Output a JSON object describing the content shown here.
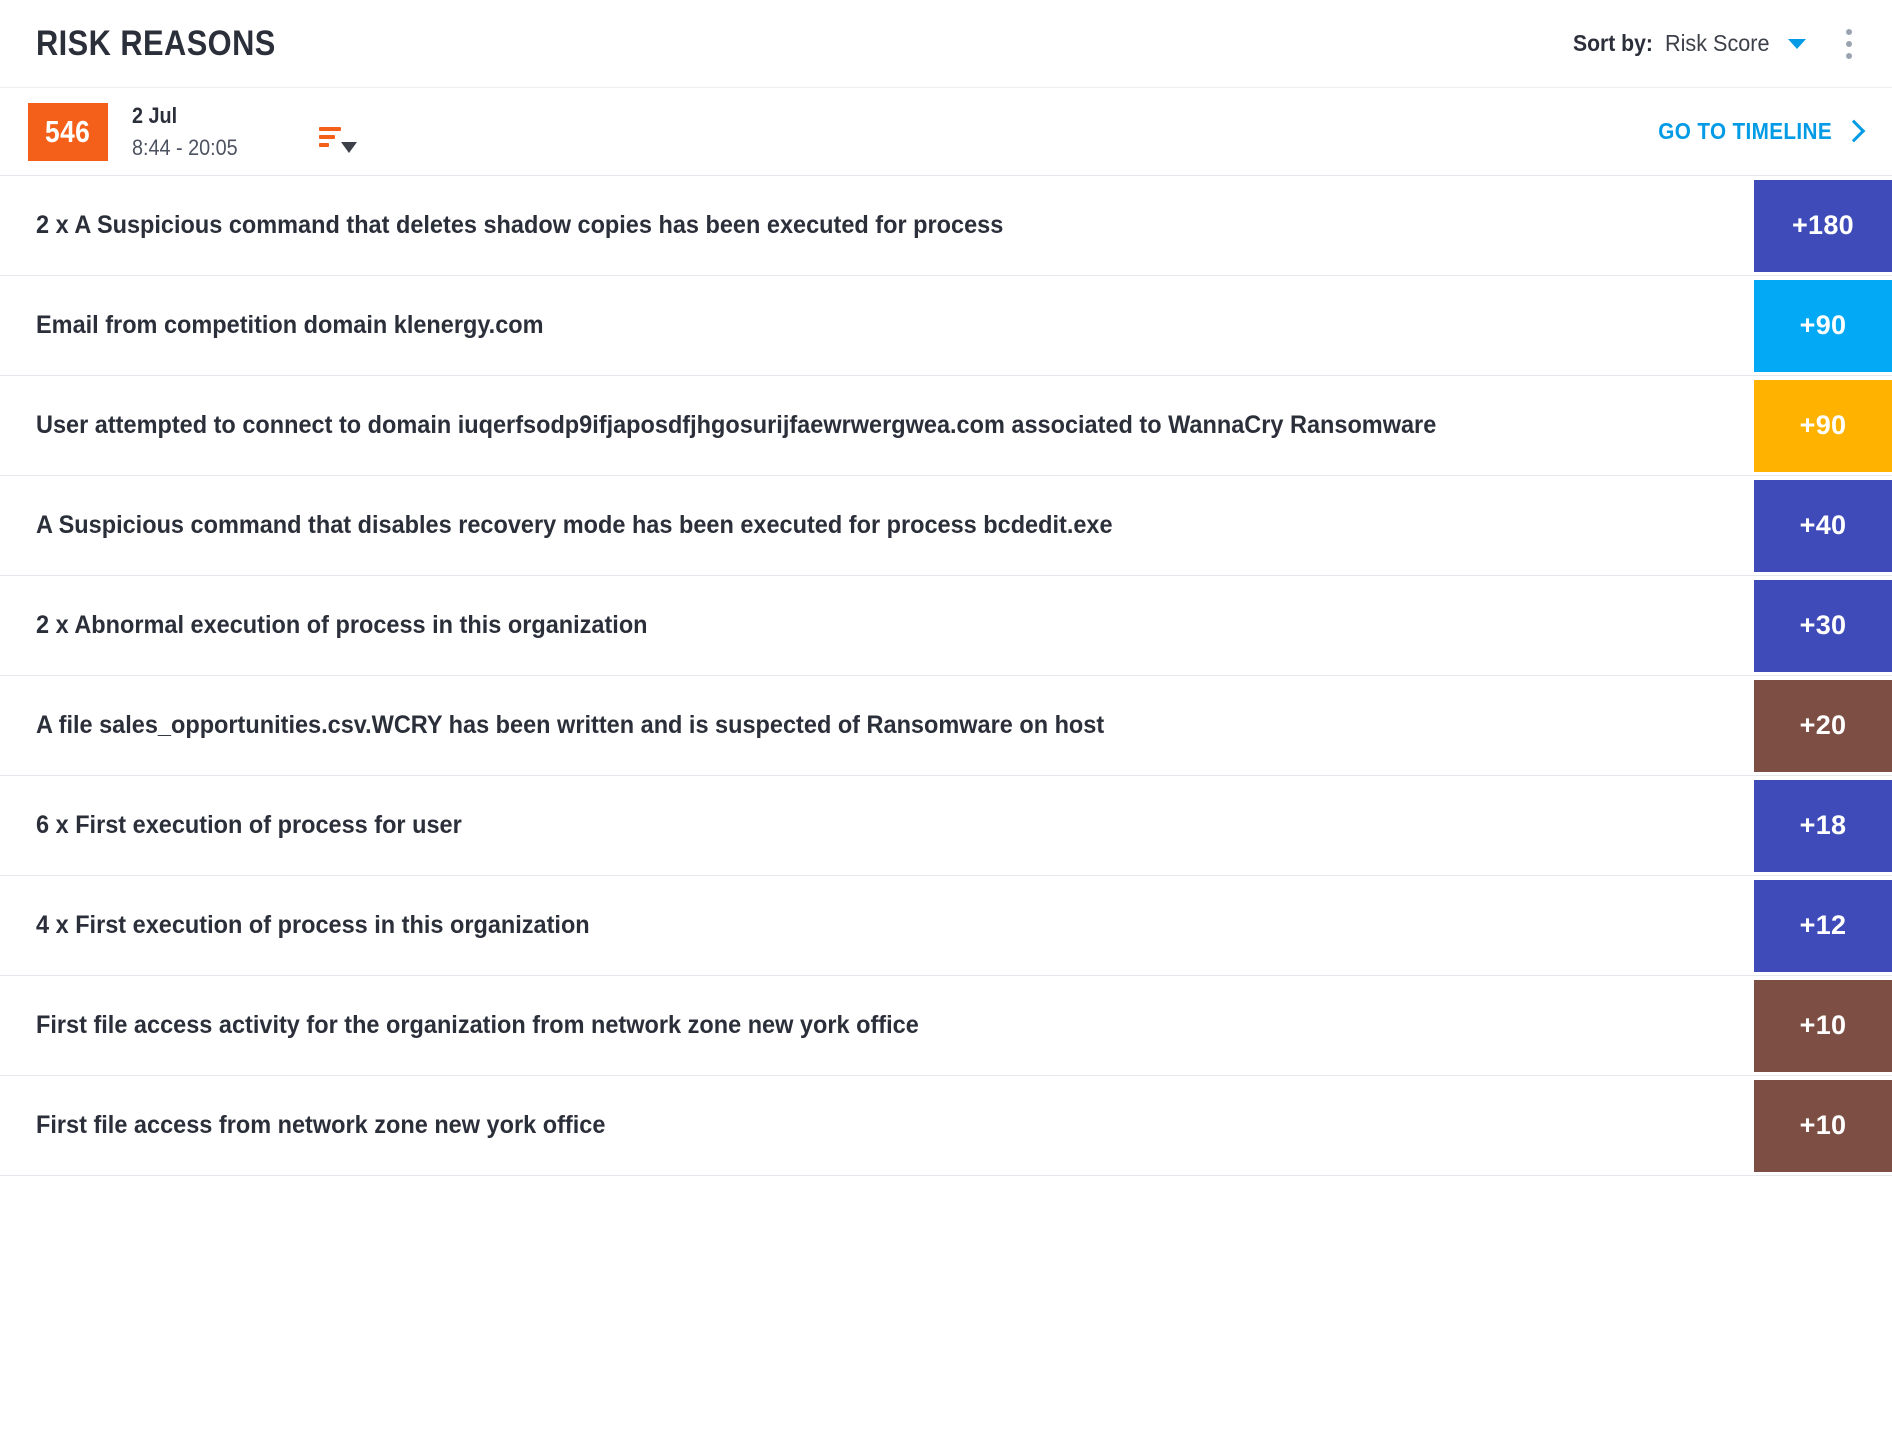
{
  "header": {
    "title": "RISK REASONS",
    "sort_label": "Sort by:",
    "sort_value": "Risk Score",
    "caret_icon": "chevron-down-icon",
    "menu_icon": "kebab-menu-icon"
  },
  "subheader": {
    "score": "546",
    "date": "2 Jul",
    "time_range": "8:44 - 20:05",
    "filter_icon": "sort-filter-icon",
    "filter_caret_icon": "chevron-down-icon",
    "timeline_link": "GO TO TIMELINE",
    "timeline_arrow_icon": "chevron-right-icon",
    "score_color": "#f4601a",
    "link_color": "#039be5"
  },
  "reasons": [
    {
      "text": "2 x A Suspicious command that deletes shadow copies has been executed for process",
      "score": "+180",
      "color": "#3f4bb8"
    },
    {
      "text": "Email from competition domain klenergy.com",
      "score": "+90",
      "color": "#03a9f4"
    },
    {
      "text": "User attempted to connect to domain iuqerfsodp9ifjaposdfjhgosurijfaewrwergwea.com associated to WannaCry Ransomware",
      "score": "+90",
      "color": "#ffb300"
    },
    {
      "text": "A Suspicious command that disables recovery mode has been executed for process bcdedit.exe",
      "score": "+40",
      "color": "#3f4bb8"
    },
    {
      "text": "2 x Abnormal execution of process in this organization",
      "score": "+30",
      "color": "#3f4bb8"
    },
    {
      "text": "A file sales_opportunities.csv.WCRY has been written and is suspected of Ransomware on host",
      "score": "+20",
      "color": "#7d4f44"
    },
    {
      "text": "6 x First execution of process for user",
      "score": "+18",
      "color": "#3f4bb8"
    },
    {
      "text": "4 x First execution of process in this organization",
      "score": "+12",
      "color": "#3f4bb8"
    },
    {
      "text": "First file access activity for the organization from network zone new york office",
      "score": "+10",
      "color": "#7d4f44"
    },
    {
      "text": "First file access from network zone new york office",
      "score": "+10",
      "color": "#7d4f44"
    }
  ]
}
